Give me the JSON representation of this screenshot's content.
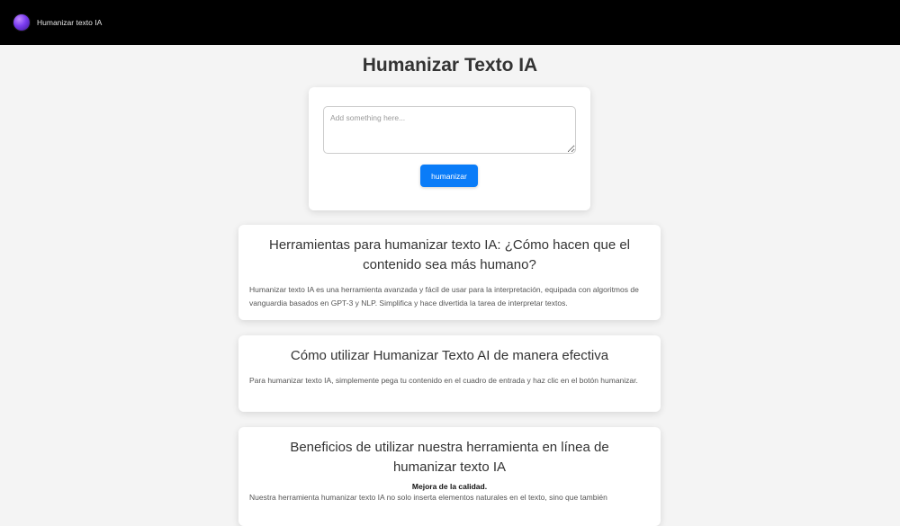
{
  "header": {
    "brand": "Humanizar texto IA",
    "logo_icon": "purple-orb-logo-icon"
  },
  "page_title": "Humanizar Texto IA",
  "tool": {
    "placeholder": "Add something here...",
    "value": "",
    "button_label": "humanizar",
    "button_color": "#0a7cf8"
  },
  "sections": [
    {
      "title": "Herramientas para humanizar texto IA: ¿Cómo hacen que el contenido sea más humano?",
      "body": "Humanizar texto IA es una herramienta avanzada y fácil de usar para la interpretación, equipada con algoritmos de vanguardia basados en GPT-3 y NLP. Simplifica y hace divertida la tarea de interpretar textos."
    },
    {
      "title": "Cómo utilizar Humanizar Texto AI de manera efectiva",
      "body": "Para humanizar texto IA, simplemente pega tu contenido en el cuadro de entrada y haz clic en el botón humanizar."
    },
    {
      "title": "Beneficios de utilizar nuestra herramienta en línea de humanizar texto IA",
      "subheading": "Mejora de la calidad.",
      "body": "Nuestra herramienta humanizar texto IA no solo inserta elementos naturales en el texto, sino que también"
    }
  ]
}
